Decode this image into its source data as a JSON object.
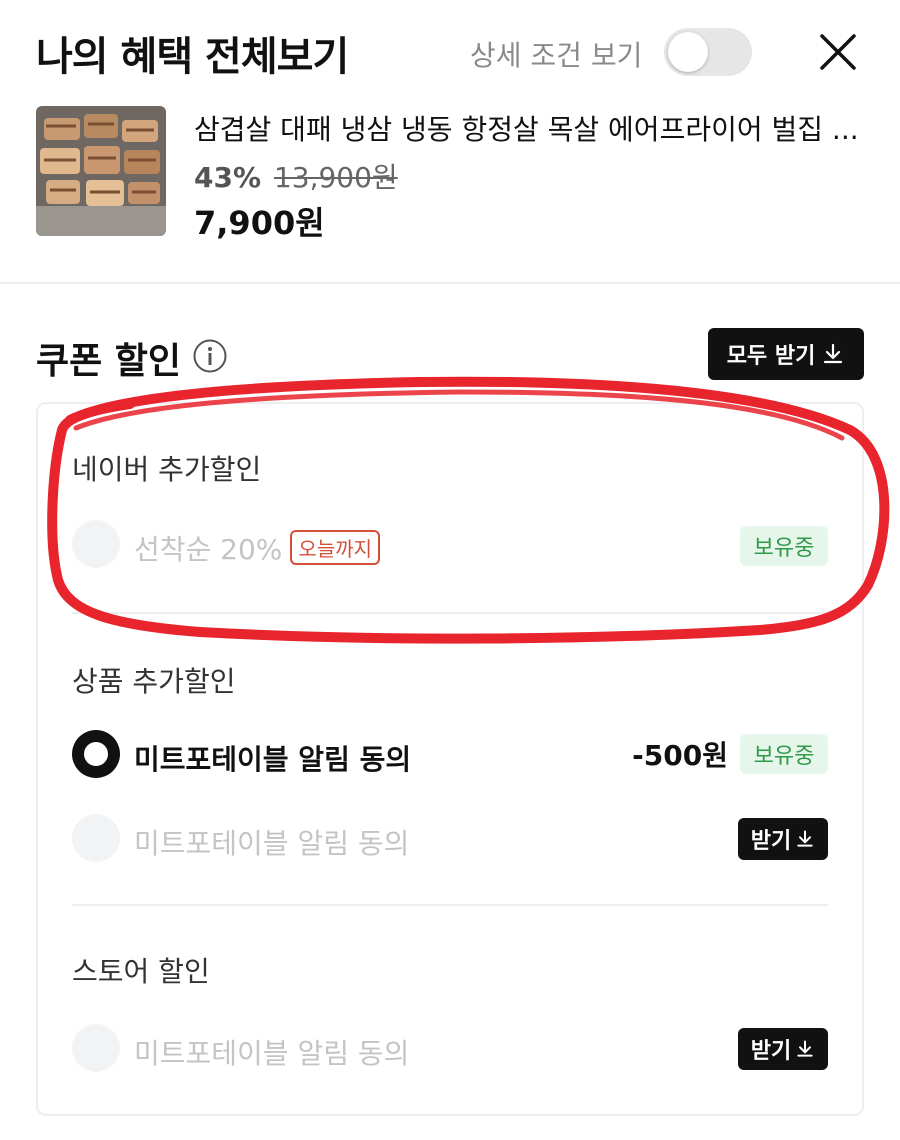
{
  "header": {
    "title": "나의 혜택 전체보기",
    "detail_toggle_label": "상세 조건 보기",
    "detail_toggle_on": false,
    "close_icon": "close-icon"
  },
  "product": {
    "name": "삼겹살 대패 냉삼 냉동 항정살 목살 에어프라이어 벌집 ...",
    "discount": "43%",
    "original_price": "13,900원",
    "final_price": "7,900원"
  },
  "coupon": {
    "title": "쿠폰 할인",
    "info_icon": "info-icon",
    "receive_all_label": "모두 받기",
    "download_icon": "download-icon"
  },
  "sections": {
    "naver": {
      "label": "네이버 추가할인",
      "item": {
        "label": "선착순 20%",
        "badge_today": "오늘까지",
        "status": "보유중",
        "selected": false
      }
    },
    "product": {
      "label": "상품 추가할인",
      "items": [
        {
          "label": "미트포테이블 알림 동의",
          "amount": "-500원",
          "status": "보유중",
          "selected": true
        },
        {
          "label": "미트포테이블 알림 동의",
          "action": "받기",
          "selected": false
        }
      ]
    },
    "store": {
      "label": "스토어 할인",
      "item": {
        "label": "미트포테이블 알림 동의",
        "action": "받기",
        "selected": false
      }
    }
  },
  "colors": {
    "highlight_stroke": "#e8242c",
    "owned_badge_bg": "#e7f6ea",
    "owned_badge_text": "#2e9a4a",
    "today_badge": "#d2503a"
  }
}
